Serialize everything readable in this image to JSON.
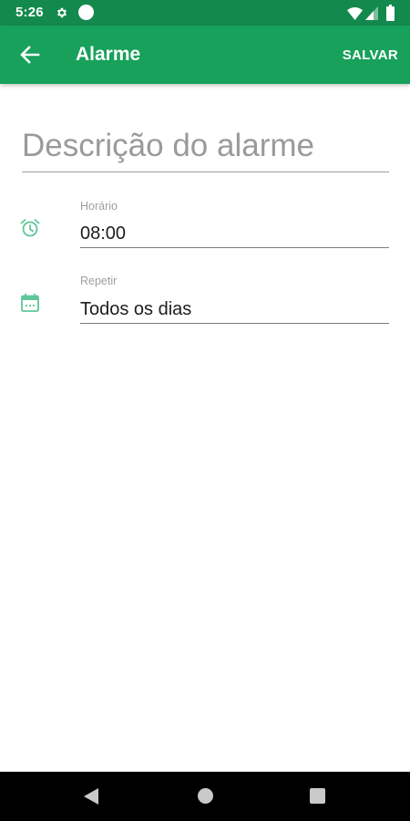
{
  "status_bar": {
    "time": "5:26",
    "background": "#13894d"
  },
  "app_bar": {
    "title": "Alarme",
    "save_label": "SALVAR",
    "background": "#17a15a"
  },
  "description": {
    "placeholder": "Descrição do alarme",
    "value": ""
  },
  "time_field": {
    "label": "Horário",
    "value": "08:00",
    "icon": "alarm-clock-icon"
  },
  "repeat_field": {
    "label": "Repetir",
    "value": "Todos os dias",
    "icon": "calendar-icon"
  },
  "colors": {
    "accent": "#17a15a",
    "icon_tint": "#5fc79a"
  }
}
